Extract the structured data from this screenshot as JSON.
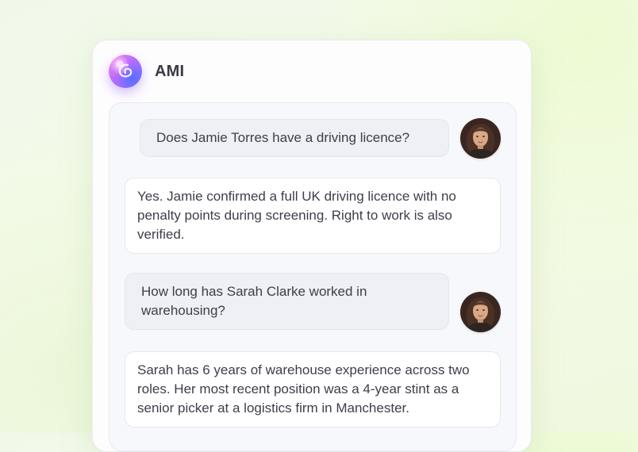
{
  "header": {
    "title": "AMI",
    "logo_icon": "gradient-orb-icon"
  },
  "colors": {
    "accent_start": "#ff8ee8",
    "accent_end": "#6e7bff",
    "user_bubble": "#eef0f5",
    "bot_bubble": "#ffffff"
  },
  "messages": [
    {
      "role": "user",
      "text": "Does Jamie Torres have a driving licence?",
      "avatar": "user-avatar"
    },
    {
      "role": "assistant",
      "text": "Yes. Jamie confirmed a full UK driving licence with no penalty points during screening. Right to work is also verified."
    },
    {
      "role": "user",
      "text": "How long has Sarah Clarke worked in warehousing?",
      "avatar": "user-avatar"
    },
    {
      "role": "assistant",
      "text": "Sarah has 6 years of warehouse experience across two roles. Her most recent position was a 4-year stint as a senior picker at a logistics firm in Manchester."
    }
  ]
}
